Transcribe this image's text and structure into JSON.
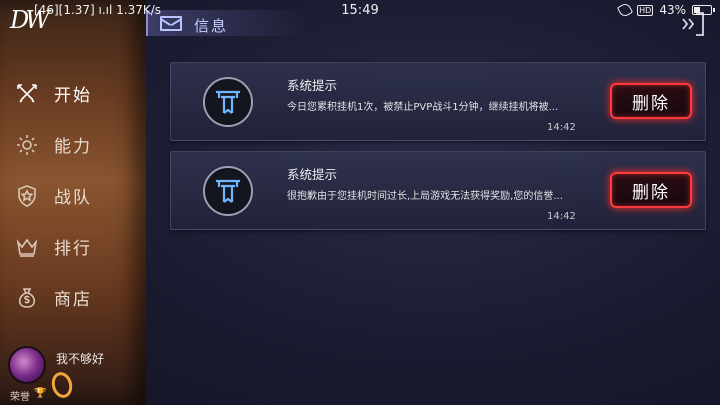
{
  "status_bar": {
    "left": "[46][1.37] ı.ıl 1.37K/s",
    "time": "15:49",
    "hd_badge": "HD",
    "battery": "43%",
    "battery_level": 0.43
  },
  "app": {
    "logo": "DW"
  },
  "sidebar": {
    "items": [
      {
        "label": "开始",
        "icon": "crossed-swords-icon",
        "active": true
      },
      {
        "label": "能力",
        "icon": "gear-icon",
        "active": false
      },
      {
        "label": "战队",
        "icon": "shield-star-icon",
        "active": false
      },
      {
        "label": "排行",
        "icon": "crown-icon",
        "active": false
      },
      {
        "label": "商店",
        "icon": "money-bag-icon",
        "active": false
      }
    ],
    "profile": {
      "username": "我不够好",
      "rank_label": "荣誉",
      "trophy": "🏆"
    }
  },
  "header": {
    "title": "信息",
    "icon": "mail-icon",
    "exit_icon": "exit-icon"
  },
  "messages": [
    {
      "title": "系统提示",
      "body": "今日您累积挂机1次，被禁止PVP战斗1分钟，继续挂机将被...",
      "time": "14:42",
      "delete_label": "删除"
    },
    {
      "title": "系统提示",
      "body": "很抱歉由于您挂机时间过长,上局游戏无法获得奖励,您的信誉...",
      "time": "14:42",
      "delete_label": "删除"
    }
  ],
  "colors": {
    "accent_red": "#ff3b3b",
    "header_text": "#c7ceff",
    "background": "#1a1b30"
  }
}
